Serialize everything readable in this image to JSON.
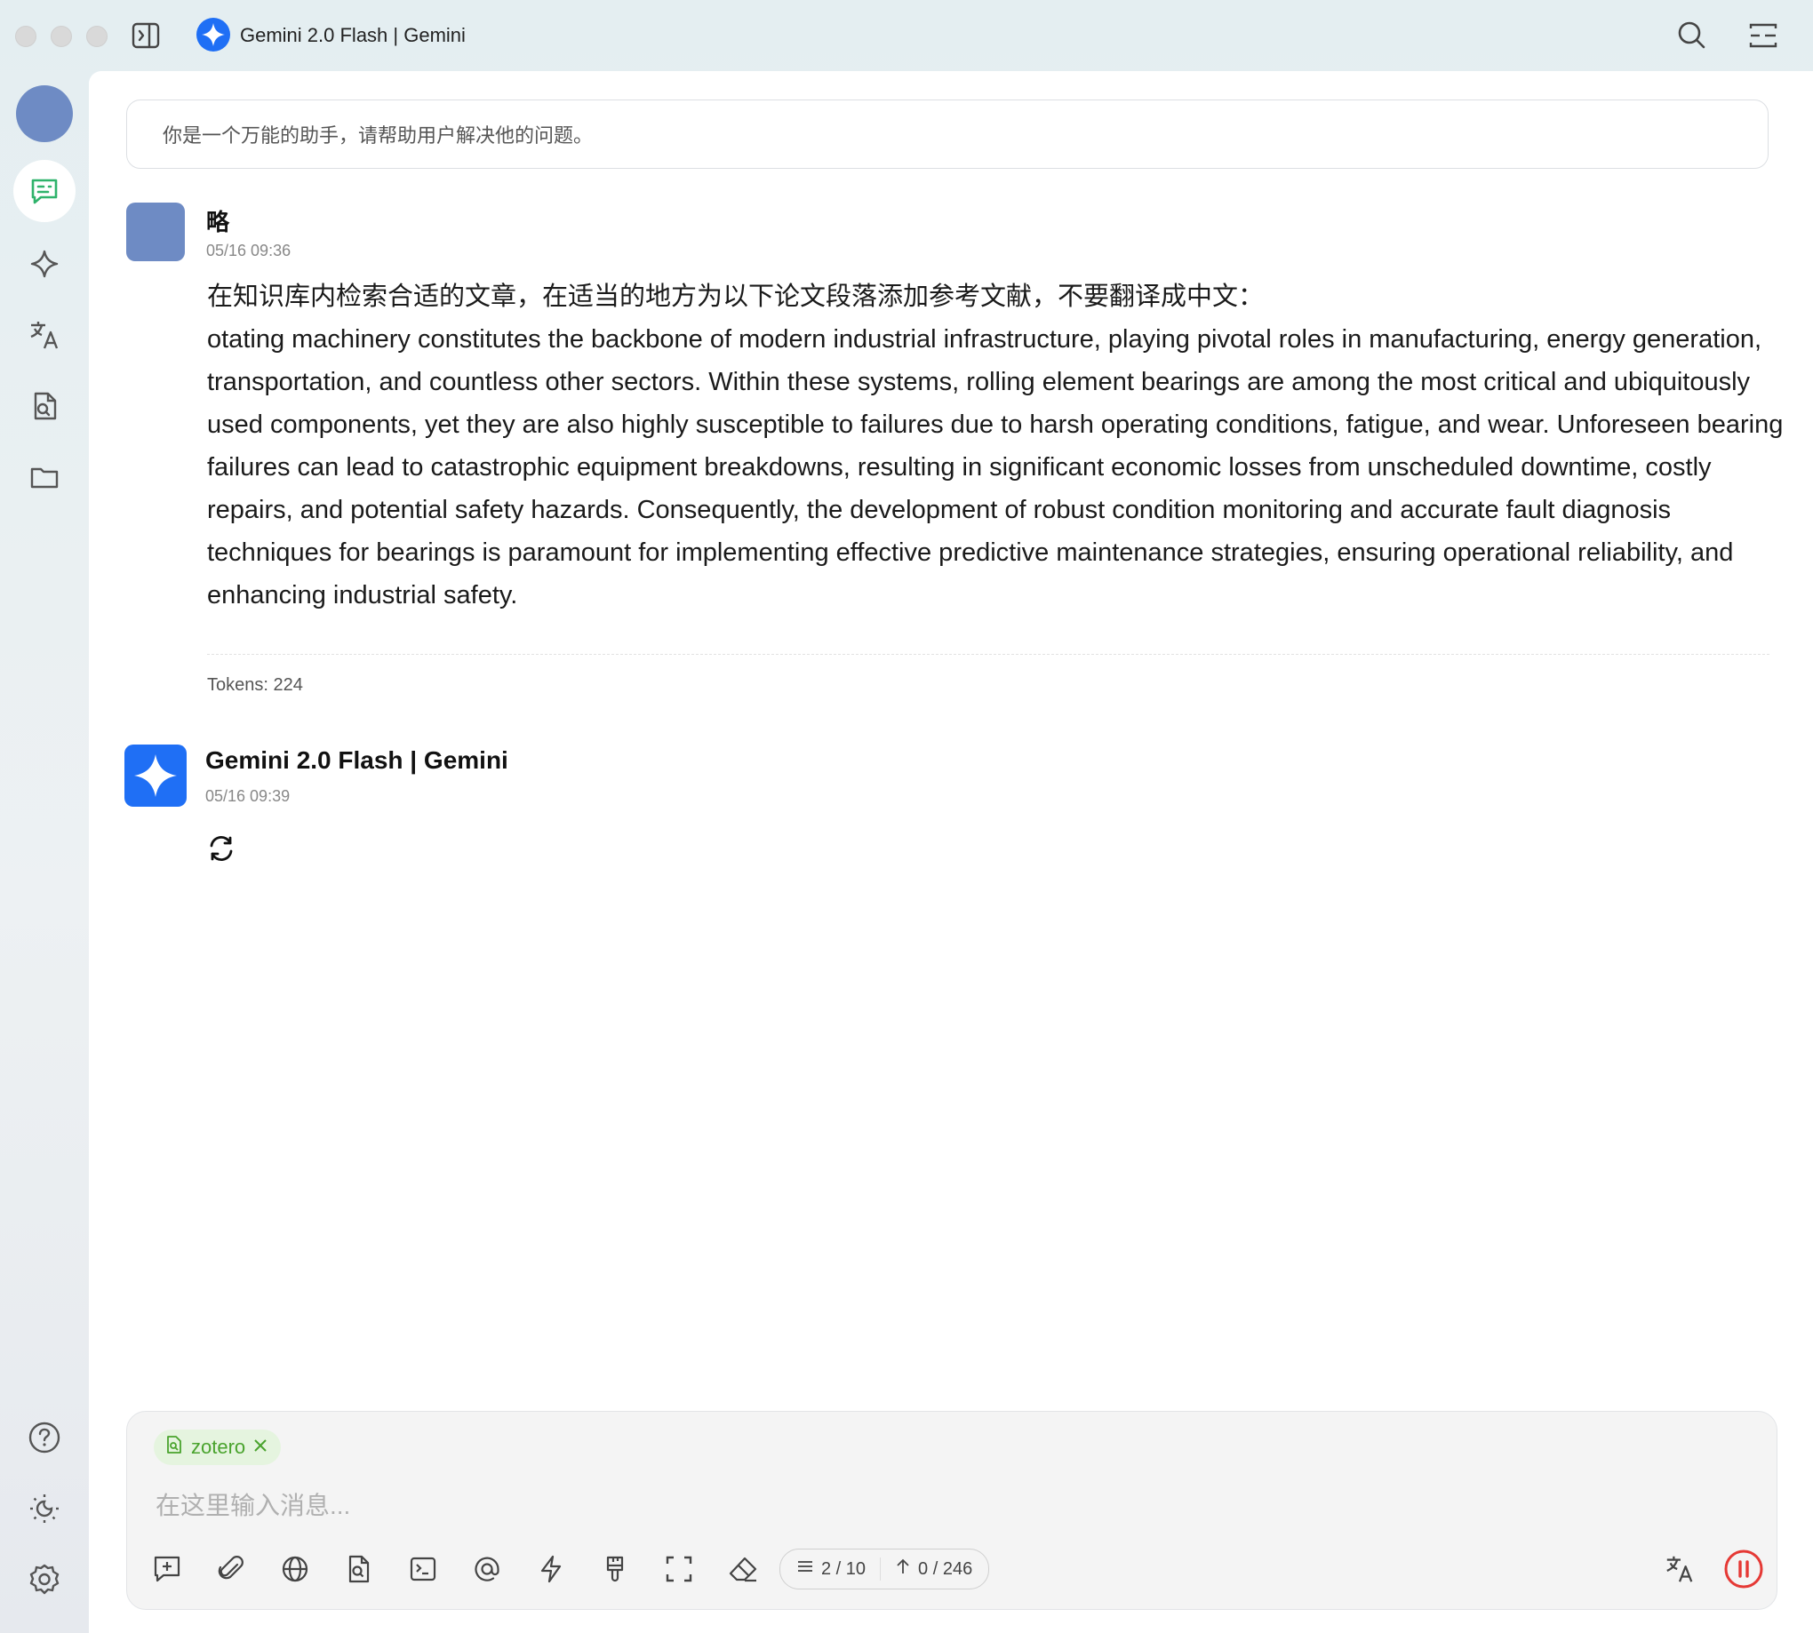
{
  "window": {
    "title": "Gemini 2.0 Flash | Gemini"
  },
  "colors": {
    "accent": "#1f6ff5",
    "chip_bg": "#e5f4df",
    "chip_text": "#49a32d",
    "stop": "#e53935",
    "active_icon": "#2fb36b"
  },
  "rail": {
    "top_icons": [
      "avatar",
      "chat-icon",
      "sparkle-icon",
      "translate-icon",
      "document-search-icon",
      "folder-icon"
    ],
    "bottom_icons": [
      "help-icon",
      "theme-icon",
      "settings-icon"
    ]
  },
  "system_prompt": "你是一个万能的助手，请帮助用户解决他的问题。",
  "messages": {
    "user": {
      "name": "略",
      "time": "05/16 09:36",
      "line1": "在知识库内检索合适的文章，在适当的地方为以下论文段落添加参考文献，不要翻译成中文：",
      "line2": "otating machinery constitutes the backbone of modern industrial infrastructure, playing pivotal roles in manufacturing, energy generation, transportation, and countless other sectors. Within these systems, rolling element bearings are among the most critical and ubiquitously used components, yet they are also highly susceptible to failures due to harsh operating conditions, fatigue, and wear. Unforeseen bearing failures can lead to catastrophic equipment breakdowns, resulting in significant economic losses from unscheduled downtime, costly repairs, and potential safety hazards. Consequently, the development of robust condition monitoring and accurate fault diagnosis techniques for bearings is paramount for implementing effective predictive maintenance strategies, ensuring operational reliability, and enhancing industrial safety.",
      "tokens": "Tokens: 224"
    },
    "assistant": {
      "name": "Gemini 2.0 Flash | Gemini",
      "time": "05/16 09:39"
    }
  },
  "input": {
    "chip_label": "zotero",
    "placeholder": "在这里输入消息...",
    "value": "",
    "context_count": "2 / 10",
    "token_count": "0 / 246"
  }
}
